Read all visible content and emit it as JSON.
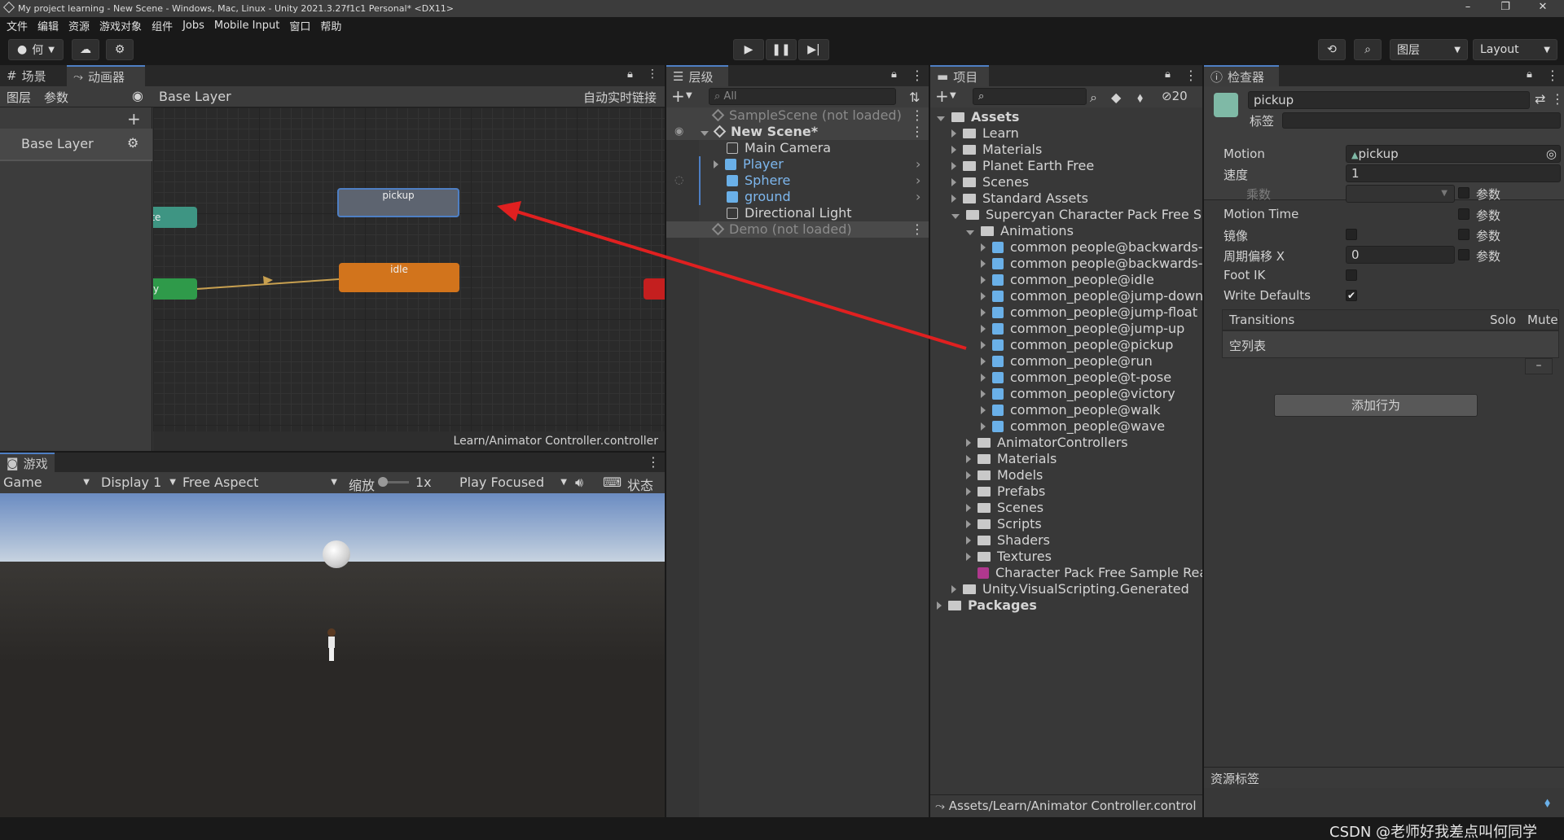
{
  "window": {
    "title": "My project learning - New Scene - Windows, Mac, Linux - Unity 2021.3.27f1c1 Personal* <DX11>",
    "controls": [
      "–",
      "❐",
      "✕"
    ]
  },
  "menu": [
    "文件",
    "编辑",
    "资源",
    "游戏对象",
    "组件",
    "Jobs",
    "Mobile Input",
    "窗口",
    "帮助"
  ],
  "toolbar": {
    "account_label": "何",
    "layers_label": "图层",
    "layout_label": "Layout"
  },
  "animator_panel": {
    "tabs": [
      "场景",
      "动画器"
    ],
    "sub_tabs": [
      "图层",
      "参数"
    ],
    "breadcrumb": "Base Layer",
    "auto_live_link": "自动实时链接",
    "layer_item": "Base Layer",
    "states": {
      "pickup": "pickup",
      "idle": "idle",
      "partial_left_top": "ate",
      "partial_left_bottom": "y"
    },
    "footer_path": "Learn/Animator Controller.controller"
  },
  "game_panel": {
    "tab": "游戏",
    "game_dropdown": "Game",
    "display": "Display 1",
    "aspect": "Free Aspect",
    "scale_label": "缩放",
    "scale_value": "1x",
    "play_mode": "Play Focused",
    "stats": "状态"
  },
  "hierarchy": {
    "tab": "层级",
    "search_placeholder": "All",
    "items": [
      {
        "label": "SampleScene (not loaded)",
        "type": "scene",
        "dim": true
      },
      {
        "label": "New Scene*",
        "type": "scene",
        "bold": true
      },
      {
        "label": "Main Camera",
        "type": "object"
      },
      {
        "label": "Player",
        "type": "prefab"
      },
      {
        "label": "Sphere",
        "type": "prefab"
      },
      {
        "label": "ground",
        "type": "prefab"
      },
      {
        "label": "Directional Light",
        "type": "object"
      },
      {
        "label": "Demo (not loaded)",
        "type": "scene",
        "dim": true
      }
    ]
  },
  "project": {
    "tab": "项目",
    "hidden_count": "20",
    "tree": [
      {
        "label": "Assets",
        "kind": "folder",
        "bold": true
      },
      {
        "label": "Learn",
        "kind": "folder"
      },
      {
        "label": "Materials",
        "kind": "folder"
      },
      {
        "label": "Planet Earth Free",
        "kind": "folder"
      },
      {
        "label": "Scenes",
        "kind": "folder"
      },
      {
        "label": "Standard Assets",
        "kind": "folder"
      },
      {
        "label": "Supercyan Character Pack Free Samp",
        "kind": "folder"
      },
      {
        "label": "Animations",
        "kind": "folder"
      },
      {
        "label": "common people@backwards-ru",
        "kind": "model"
      },
      {
        "label": "common people@backwards-wa",
        "kind": "model"
      },
      {
        "label": "common_people@idle",
        "kind": "model"
      },
      {
        "label": "common_people@jump-down",
        "kind": "model"
      },
      {
        "label": "common_people@jump-float",
        "kind": "model"
      },
      {
        "label": "common_people@jump-up",
        "kind": "model"
      },
      {
        "label": "common_people@pickup",
        "kind": "model"
      },
      {
        "label": "common_people@run",
        "kind": "model"
      },
      {
        "label": "common_people@t-pose",
        "kind": "model"
      },
      {
        "label": "common_people@victory",
        "kind": "model"
      },
      {
        "label": "common_people@walk",
        "kind": "model"
      },
      {
        "label": "common_people@wave",
        "kind": "model"
      },
      {
        "label": "AnimatorControllers",
        "kind": "folder"
      },
      {
        "label": "Materials",
        "kind": "folder"
      },
      {
        "label": "Models",
        "kind": "folder"
      },
      {
        "label": "Prefabs",
        "kind": "folder"
      },
      {
        "label": "Scenes",
        "kind": "folder"
      },
      {
        "label": "Scripts",
        "kind": "folder"
      },
      {
        "label": "Shaders",
        "kind": "folder"
      },
      {
        "label": "Textures",
        "kind": "folder"
      },
      {
        "label": "Character Pack Free Sample Readi",
        "kind": "pdf"
      },
      {
        "label": "Unity.VisualScripting.Generated",
        "kind": "folder"
      },
      {
        "label": "Packages",
        "kind": "folder",
        "bold": true
      }
    ],
    "footer_path": "Assets/Learn/Animator Controller.control"
  },
  "inspector": {
    "tab": "检查器",
    "name": "pickup",
    "tag_label": "标签",
    "rows": {
      "motion_label": "Motion",
      "motion_value": "pickup",
      "speed_label": "速度",
      "speed_value": "1",
      "multiplier_label": "乘数",
      "param_label": "参数",
      "motion_time_label": "Motion Time",
      "mirror_label": "镜像",
      "cycle_offset_label": "周期偏移 X",
      "cycle_offset_value": "0",
      "foot_ik_label": "Foot IK",
      "write_defaults_label": "Write Defaults"
    },
    "transitions": {
      "header": "Transitions",
      "solo": "Solo",
      "mute": "Mute",
      "empty": "空列表",
      "remove": "–"
    },
    "add_behaviour": "添加行为",
    "asset_labels": "资源标签"
  },
  "watermark": "CSDN @老师好我差点叫何同学",
  "colors": {
    "pickup_node": "#5d6470",
    "idle_node": "#d2741c",
    "green_node": "#2f9a4a",
    "teal_node": "#3e9583",
    "red_node": "#c41f1f",
    "arrow": "#e02020",
    "prefab_blue": "#6ab0e8"
  }
}
